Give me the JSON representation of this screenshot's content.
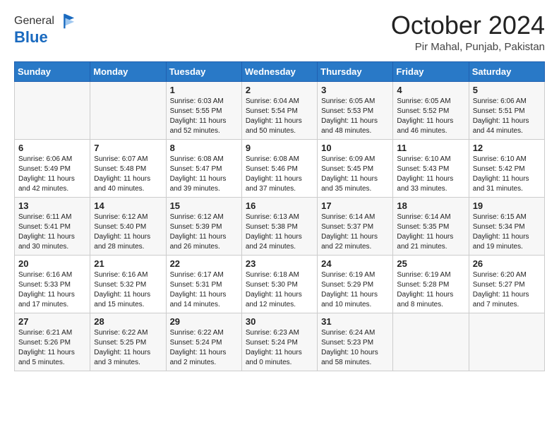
{
  "logo": {
    "general": "General",
    "blue": "Blue"
  },
  "header": {
    "month": "October 2024",
    "location": "Pir Mahal, Punjab, Pakistan"
  },
  "days_of_week": [
    "Sunday",
    "Monday",
    "Tuesday",
    "Wednesday",
    "Thursday",
    "Friday",
    "Saturday"
  ],
  "weeks": [
    [
      {
        "day": "",
        "sunrise": "",
        "sunset": "",
        "daylight": ""
      },
      {
        "day": "",
        "sunrise": "",
        "sunset": "",
        "daylight": ""
      },
      {
        "day": "1",
        "sunrise": "Sunrise: 6:03 AM",
        "sunset": "Sunset: 5:55 PM",
        "daylight": "Daylight: 11 hours and 52 minutes."
      },
      {
        "day": "2",
        "sunrise": "Sunrise: 6:04 AM",
        "sunset": "Sunset: 5:54 PM",
        "daylight": "Daylight: 11 hours and 50 minutes."
      },
      {
        "day": "3",
        "sunrise": "Sunrise: 6:05 AM",
        "sunset": "Sunset: 5:53 PM",
        "daylight": "Daylight: 11 hours and 48 minutes."
      },
      {
        "day": "4",
        "sunrise": "Sunrise: 6:05 AM",
        "sunset": "Sunset: 5:52 PM",
        "daylight": "Daylight: 11 hours and 46 minutes."
      },
      {
        "day": "5",
        "sunrise": "Sunrise: 6:06 AM",
        "sunset": "Sunset: 5:51 PM",
        "daylight": "Daylight: 11 hours and 44 minutes."
      }
    ],
    [
      {
        "day": "6",
        "sunrise": "Sunrise: 6:06 AM",
        "sunset": "Sunset: 5:49 PM",
        "daylight": "Daylight: 11 hours and 42 minutes."
      },
      {
        "day": "7",
        "sunrise": "Sunrise: 6:07 AM",
        "sunset": "Sunset: 5:48 PM",
        "daylight": "Daylight: 11 hours and 40 minutes."
      },
      {
        "day": "8",
        "sunrise": "Sunrise: 6:08 AM",
        "sunset": "Sunset: 5:47 PM",
        "daylight": "Daylight: 11 hours and 39 minutes."
      },
      {
        "day": "9",
        "sunrise": "Sunrise: 6:08 AM",
        "sunset": "Sunset: 5:46 PM",
        "daylight": "Daylight: 11 hours and 37 minutes."
      },
      {
        "day": "10",
        "sunrise": "Sunrise: 6:09 AM",
        "sunset": "Sunset: 5:45 PM",
        "daylight": "Daylight: 11 hours and 35 minutes."
      },
      {
        "day": "11",
        "sunrise": "Sunrise: 6:10 AM",
        "sunset": "Sunset: 5:43 PM",
        "daylight": "Daylight: 11 hours and 33 minutes."
      },
      {
        "day": "12",
        "sunrise": "Sunrise: 6:10 AM",
        "sunset": "Sunset: 5:42 PM",
        "daylight": "Daylight: 11 hours and 31 minutes."
      }
    ],
    [
      {
        "day": "13",
        "sunrise": "Sunrise: 6:11 AM",
        "sunset": "Sunset: 5:41 PM",
        "daylight": "Daylight: 11 hours and 30 minutes."
      },
      {
        "day": "14",
        "sunrise": "Sunrise: 6:12 AM",
        "sunset": "Sunset: 5:40 PM",
        "daylight": "Daylight: 11 hours and 28 minutes."
      },
      {
        "day": "15",
        "sunrise": "Sunrise: 6:12 AM",
        "sunset": "Sunset: 5:39 PM",
        "daylight": "Daylight: 11 hours and 26 minutes."
      },
      {
        "day": "16",
        "sunrise": "Sunrise: 6:13 AM",
        "sunset": "Sunset: 5:38 PM",
        "daylight": "Daylight: 11 hours and 24 minutes."
      },
      {
        "day": "17",
        "sunrise": "Sunrise: 6:14 AM",
        "sunset": "Sunset: 5:37 PM",
        "daylight": "Daylight: 11 hours and 22 minutes."
      },
      {
        "day": "18",
        "sunrise": "Sunrise: 6:14 AM",
        "sunset": "Sunset: 5:35 PM",
        "daylight": "Daylight: 11 hours and 21 minutes."
      },
      {
        "day": "19",
        "sunrise": "Sunrise: 6:15 AM",
        "sunset": "Sunset: 5:34 PM",
        "daylight": "Daylight: 11 hours and 19 minutes."
      }
    ],
    [
      {
        "day": "20",
        "sunrise": "Sunrise: 6:16 AM",
        "sunset": "Sunset: 5:33 PM",
        "daylight": "Daylight: 11 hours and 17 minutes."
      },
      {
        "day": "21",
        "sunrise": "Sunrise: 6:16 AM",
        "sunset": "Sunset: 5:32 PM",
        "daylight": "Daylight: 11 hours and 15 minutes."
      },
      {
        "day": "22",
        "sunrise": "Sunrise: 6:17 AM",
        "sunset": "Sunset: 5:31 PM",
        "daylight": "Daylight: 11 hours and 14 minutes."
      },
      {
        "day": "23",
        "sunrise": "Sunrise: 6:18 AM",
        "sunset": "Sunset: 5:30 PM",
        "daylight": "Daylight: 11 hours and 12 minutes."
      },
      {
        "day": "24",
        "sunrise": "Sunrise: 6:19 AM",
        "sunset": "Sunset: 5:29 PM",
        "daylight": "Daylight: 11 hours and 10 minutes."
      },
      {
        "day": "25",
        "sunrise": "Sunrise: 6:19 AM",
        "sunset": "Sunset: 5:28 PM",
        "daylight": "Daylight: 11 hours and 8 minutes."
      },
      {
        "day": "26",
        "sunrise": "Sunrise: 6:20 AM",
        "sunset": "Sunset: 5:27 PM",
        "daylight": "Daylight: 11 hours and 7 minutes."
      }
    ],
    [
      {
        "day": "27",
        "sunrise": "Sunrise: 6:21 AM",
        "sunset": "Sunset: 5:26 PM",
        "daylight": "Daylight: 11 hours and 5 minutes."
      },
      {
        "day": "28",
        "sunrise": "Sunrise: 6:22 AM",
        "sunset": "Sunset: 5:25 PM",
        "daylight": "Daylight: 11 hours and 3 minutes."
      },
      {
        "day": "29",
        "sunrise": "Sunrise: 6:22 AM",
        "sunset": "Sunset: 5:24 PM",
        "daylight": "Daylight: 11 hours and 2 minutes."
      },
      {
        "day": "30",
        "sunrise": "Sunrise: 6:23 AM",
        "sunset": "Sunset: 5:24 PM",
        "daylight": "Daylight: 11 hours and 0 minutes."
      },
      {
        "day": "31",
        "sunrise": "Sunrise: 6:24 AM",
        "sunset": "Sunset: 5:23 PM",
        "daylight": "Daylight: 10 hours and 58 minutes."
      },
      {
        "day": "",
        "sunrise": "",
        "sunset": "",
        "daylight": ""
      },
      {
        "day": "",
        "sunrise": "",
        "sunset": "",
        "daylight": ""
      }
    ]
  ]
}
